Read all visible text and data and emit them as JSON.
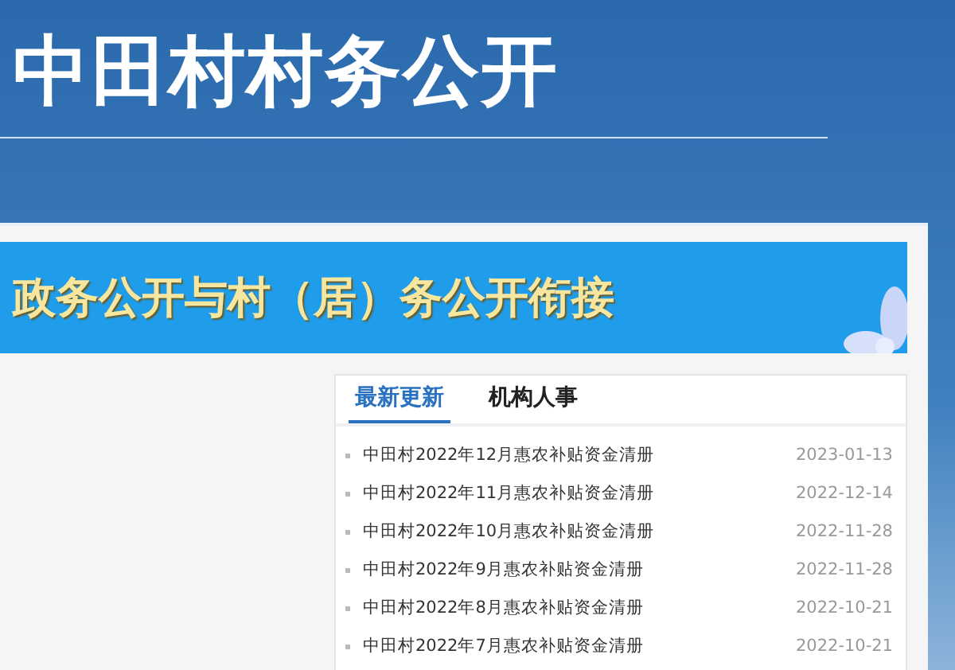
{
  "header": {
    "title": "中田村村务公开"
  },
  "banner": {
    "title": "政务公开与村（居）务公开衔接"
  },
  "tabs": [
    {
      "label": "最新更新",
      "selected": true
    },
    {
      "label": "机构人事",
      "selected": false
    }
  ],
  "items": [
    {
      "title": "中田村2022年12月惠农补贴资金清册",
      "date": "2023-01-13"
    },
    {
      "title": "中田村2022年11月惠农补贴资金清册",
      "date": "2022-12-14"
    },
    {
      "title": "中田村2022年10月惠农补贴资金清册",
      "date": "2022-11-28"
    },
    {
      "title": "中田村2022年9月惠农补贴资金清册",
      "date": "2022-11-28"
    },
    {
      "title": "中田村2022年8月惠农补贴资金清册",
      "date": "2022-10-21"
    },
    {
      "title": "中田村2022年7月惠农补贴资金清册",
      "date": "2022-10-21"
    }
  ]
}
